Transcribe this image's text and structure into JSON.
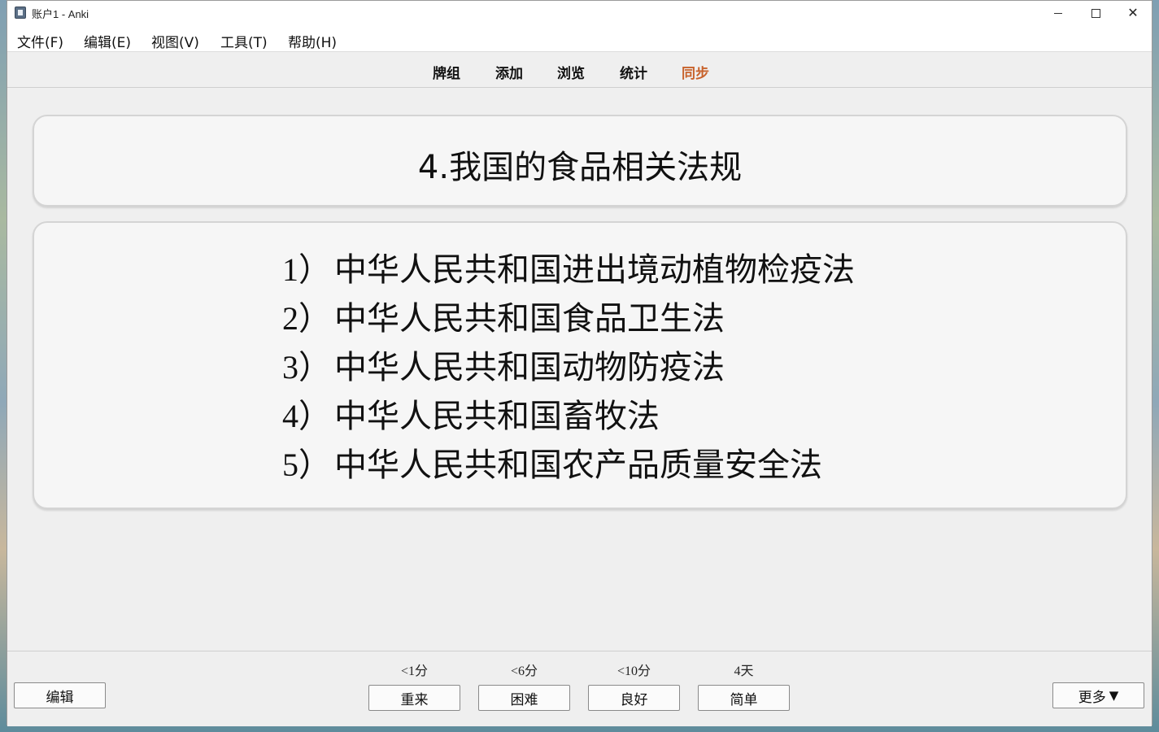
{
  "window": {
    "title": "账户1 - Anki"
  },
  "menu": [
    "文件(F)",
    "编辑(E)",
    "视图(V)",
    "工具(T)",
    "帮助(H)"
  ],
  "toolbar": {
    "decks": "牌组",
    "add": "添加",
    "browse": "浏览",
    "stats": "统计",
    "sync": "同步",
    "sync_color": "#c8622b"
  },
  "card": {
    "front": "4.我国的食品相关法规",
    "back": [
      {
        "num": "1）",
        "text": "中华人民共和国进出境动植物检疫法"
      },
      {
        "num": "2）",
        "text": "中华人民共和国食品卫生法"
      },
      {
        "num": "3）",
        "text": "中华人民共和国动物防疫法"
      },
      {
        "num": "4）",
        "text": "中华人民共和国畜牧法"
      },
      {
        "num": "5）",
        "text": "中华人民共和国农产品质量安全法"
      }
    ]
  },
  "bottom": {
    "edit": "编辑",
    "more": "更多",
    "more_arrow": "▼",
    "answers": [
      {
        "label": "重来",
        "due": "<1分"
      },
      {
        "label": "困难",
        "due": "<6分"
      },
      {
        "label": "良好",
        "due": "<10分"
      },
      {
        "label": "简单",
        "due": "4天"
      }
    ]
  },
  "icons": {
    "app": "anki-app-icon",
    "minimize": "minimize-icon",
    "maximize": "maximize-icon",
    "close": "close-icon"
  }
}
